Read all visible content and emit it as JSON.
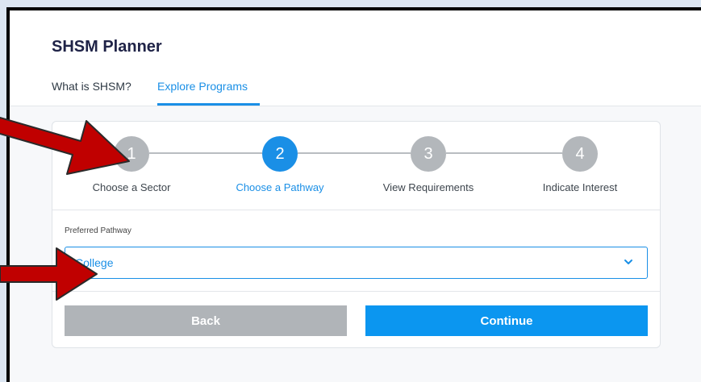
{
  "app": {
    "title": "SHSM Planner"
  },
  "tabs": [
    {
      "label": "What is SHSM?",
      "active": false
    },
    {
      "label": "Explore Programs",
      "active": true
    }
  ],
  "steps": [
    {
      "number": "1",
      "label": "Choose a Sector",
      "state": "inactive"
    },
    {
      "number": "2",
      "label": "Choose a Pathway",
      "state": "active"
    },
    {
      "number": "3",
      "label": "View Requirements",
      "state": "inactive"
    },
    {
      "number": "4",
      "label": "Indicate Interest",
      "state": "inactive"
    }
  ],
  "form": {
    "label": "Preferred Pathway",
    "selected": "College",
    "icon": "chevron-down-icon"
  },
  "buttons": {
    "back": "Back",
    "continue": "Continue"
  },
  "colors": {
    "accent": "#1a8fe6",
    "inactive_step": "#b3b7bb",
    "back_button": "#b0b4b8",
    "continue_button": "#0b96f0",
    "annotation_arrow": "#c00000"
  },
  "annotations": {
    "arrow_count": 2,
    "arrow_icon": "red-arrow-icon"
  }
}
